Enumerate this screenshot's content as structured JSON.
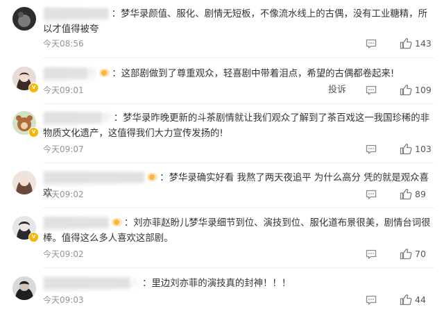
{
  "icons": {
    "comment": "comment-bubble-icon",
    "like": "thumbs-up-icon",
    "verified": "verified-badge-icon",
    "fan_badge": "fan-badge-icon"
  },
  "colors": {
    "text": "#333333",
    "meta": "#939393",
    "verified_badge": "#f7b500",
    "divider": "#ededed"
  },
  "comments": [
    {
      "username": "█████████",
      "text": "梦华录颜值、服化、剧情无短板，不像流水线上的古偶，没有工业糖精，所以才值得被夸",
      "time": "今天08:56",
      "reply_label": "",
      "likes": "143"
    },
    {
      "username": "██████凯",
      "text": "这部剧做到了尊重观众，轻喜剧中带着泪点，希望的古偶都卷起来!",
      "time": "今天09:01",
      "reply_label": "投诉",
      "likes": "109"
    },
    {
      "username": "████████安",
      "text": "梦华录昨晚更新的斗茶剧情就让我们观众了解到了茶百戏这一我国珍稀的非物质文化遗产，这值得我们大力宣传发扬的!",
      "time": "今天09:07",
      "reply_label": "",
      "likes": "103"
    },
    {
      "username": "██████████████",
      "text": "梦华录确实好看 我熬了两天夜追平 为什么高分 凭的就是观众喜欢",
      "time": "今天09:02",
      "reply_label": "",
      "likes": "89"
    },
    {
      "username": "█████████",
      "text": "刘亦菲赵盼儿梦华录细节到位、演技到位、服化道布景很美，剧情台词很棒。值得这么多人喜欢这部剧。",
      "time": "今天09:02",
      "reply_label": "",
      "likes": "70"
    },
    {
      "username": "████████████人",
      "text": "里边刘亦菲的演技真的封神！！！",
      "time": "今天09:03",
      "reply_label": "",
      "likes": "44"
    }
  ]
}
